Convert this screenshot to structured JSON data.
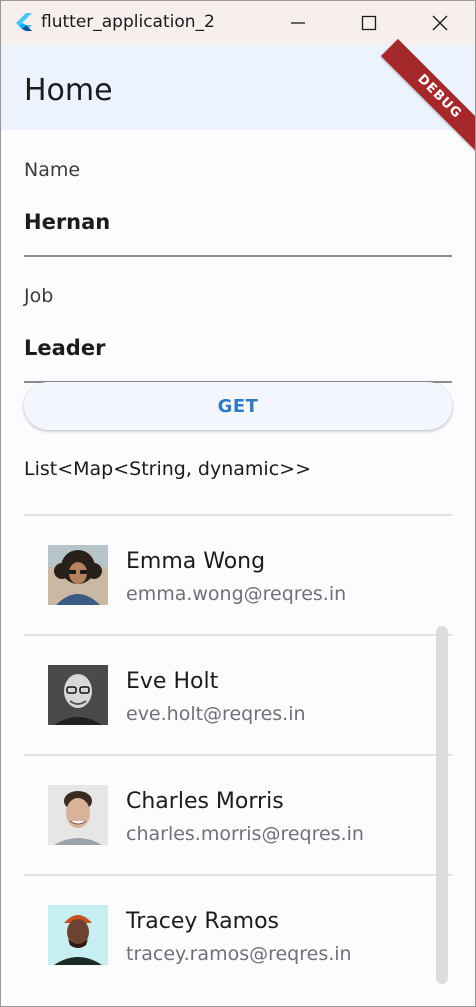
{
  "window": {
    "title": "flutter_application_2"
  },
  "appbar": {
    "title": "Home",
    "debug_banner": "DEBUG"
  },
  "form": {
    "name_label": "Name",
    "name_value": "Hernan",
    "job_label": "Job",
    "job_value": "Leader",
    "get_button": "GET"
  },
  "list": {
    "caption": "List<Map<String, dynamic>>",
    "items": [
      {
        "name": "Emma Wong",
        "email": "emma.wong@reqres.in"
      },
      {
        "name": "Eve Holt",
        "email": "eve.holt@reqres.in"
      },
      {
        "name": "Charles Morris",
        "email": "charles.morris@reqres.in"
      },
      {
        "name": "Tracey Ramos",
        "email": "tracey.ramos@reqres.in"
      }
    ]
  },
  "colors": {
    "accent": "#2f7bc4",
    "appbar_bg": "#ecf2fe",
    "debug_banner": "#a5292a"
  },
  "icons": [
    "flutter-logo-icon",
    "minimize-icon",
    "maximize-icon",
    "close-icon"
  ]
}
